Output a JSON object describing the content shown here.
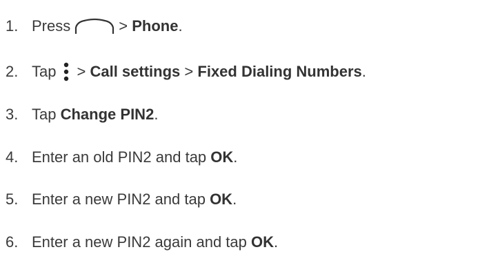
{
  "steps": [
    {
      "number": "1.",
      "text_before": "Press",
      "icon": "home-icon",
      "sep": ">",
      "target": "Phone",
      "end": "."
    },
    {
      "number": "2.",
      "text_before": "Tap",
      "icon": "overflow-menu-icon",
      "sep1": ">",
      "item1": "Call settings",
      "sep2": ">",
      "item2": "Fixed Dialing Numbers",
      "end": "."
    },
    {
      "number": "3.",
      "text_before": "Tap",
      "target": "Change PIN2",
      "end": "."
    },
    {
      "number": "4.",
      "text_before": "Enter an old PIN2 and tap",
      "target": "OK",
      "end": "."
    },
    {
      "number": "5.",
      "text_before": "Enter a new PIN2 and tap",
      "target": "OK",
      "end": "."
    },
    {
      "number": "6.",
      "text_before": "Enter a new PIN2 again and tap",
      "target": "OK",
      "end": "."
    }
  ]
}
